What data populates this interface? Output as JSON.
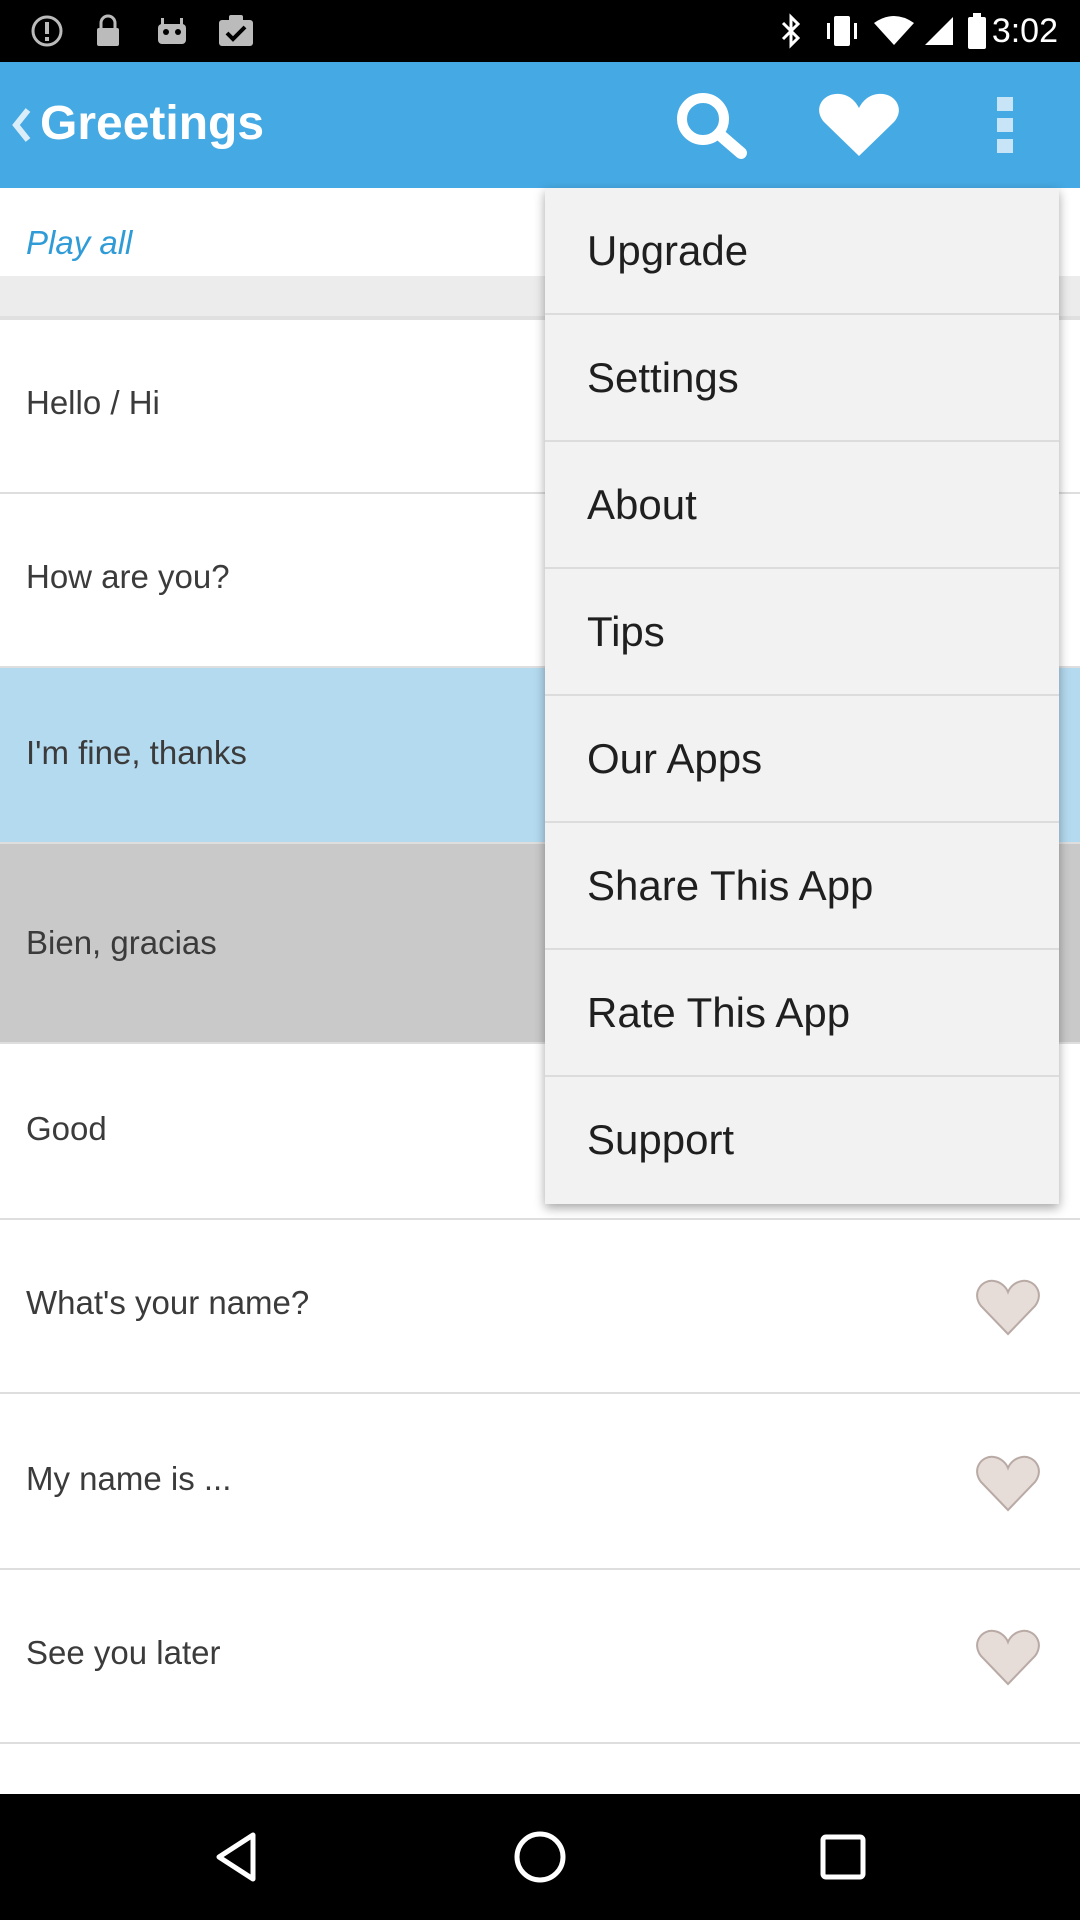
{
  "status_bar": {
    "time": "3:02",
    "icons": [
      "alert-icon",
      "lock-icon",
      "android-icon",
      "clipboard-check-icon",
      "bluetooth-icon",
      "vibrate-icon",
      "wifi-icon",
      "signal-icon",
      "battery-icon"
    ]
  },
  "app_bar": {
    "title": "Greetings",
    "icons": [
      "back-chevron-icon",
      "search-icon",
      "heart-icon",
      "more-vert-icon"
    ],
    "color": "#45a9e3"
  },
  "list": {
    "play_all": "Play all",
    "items": [
      {
        "label": "Hello / Hi"
      },
      {
        "label": "How are you?"
      },
      {
        "label": "I'm fine, thanks"
      },
      {
        "label": "Bien, gracias"
      },
      {
        "label": "Good"
      },
      {
        "label": "What's your name?"
      },
      {
        "label": "My name is ..."
      },
      {
        "label": "See you later"
      }
    ]
  },
  "menu": {
    "items": [
      {
        "label": "Upgrade"
      },
      {
        "label": "Settings"
      },
      {
        "label": "About"
      },
      {
        "label": "Tips"
      },
      {
        "label": "Our Apps"
      },
      {
        "label": "Share This App"
      },
      {
        "label": "Rate This App"
      },
      {
        "label": "Support"
      }
    ]
  },
  "nav_bar": {
    "icons": [
      "back-triangle-icon",
      "home-circle-icon",
      "recents-square-icon"
    ]
  }
}
